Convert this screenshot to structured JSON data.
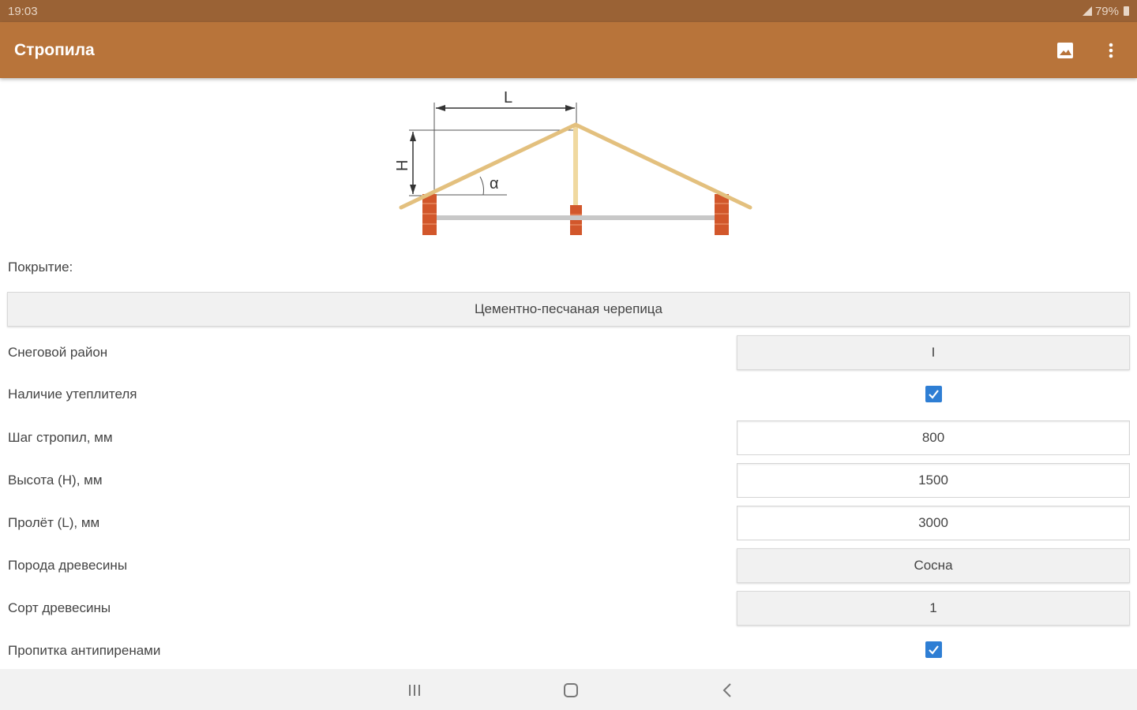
{
  "status": {
    "time": "19:03",
    "battery": "79%"
  },
  "app_bar": {
    "title": "Стропила",
    "image_icon": "image-icon",
    "menu_icon": "more-vert-icon"
  },
  "diagram": {
    "label_L": "L",
    "label_H": "H",
    "label_alpha": "α"
  },
  "form": {
    "covering_label": "Покрытие:",
    "covering_value": "Цементно-песчаная черепица",
    "snow_region_label": "Снеговой район",
    "snow_region_value": "I",
    "insulation_label": "Наличие утеплителя",
    "insulation_checked": true,
    "rafter_step_label": "Шаг стропил, мм",
    "rafter_step_value": "800",
    "height_label": "Высота (H), мм",
    "height_value": "1500",
    "span_label": "Пролёт (L), мм",
    "span_value": "3000",
    "wood_type_label": "Порода древесины",
    "wood_type_value": "Сосна",
    "wood_grade_label": "Сорт древесины",
    "wood_grade_value": "1",
    "fire_impregnation_label": "Пропитка антипиренами",
    "fire_impregnation_checked": true
  },
  "colors": {
    "app_bar": "#b8743a",
    "status_bar": "#9a6235",
    "checkbox": "#2e7ed4"
  },
  "nav": {
    "recents_icon": "recents-icon",
    "home_icon": "home-icon",
    "back_icon": "back-icon"
  }
}
